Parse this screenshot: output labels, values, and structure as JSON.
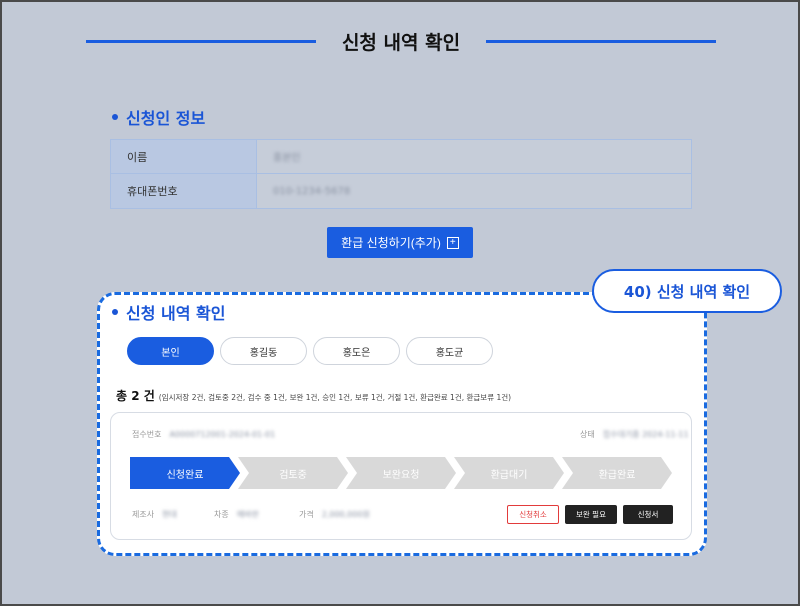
{
  "page": {
    "title": "신청 내역 확인"
  },
  "applicant": {
    "heading": "신청인 정보",
    "rows": [
      {
        "label": "이름",
        "value": "홍본인"
      },
      {
        "label": "휴대폰번호",
        "value": "010-1234-5678"
      }
    ]
  },
  "add_button": {
    "label": "환급 신청하기(추가)",
    "icon": "plus-icon"
  },
  "history": {
    "heading": "신청 내역 확인",
    "callout": "40) 신청 내역 확인",
    "tabs": [
      {
        "label": "본인",
        "active": true
      },
      {
        "label": "홍길동",
        "active": false
      },
      {
        "label": "홍도은",
        "active": false
      },
      {
        "label": "홍도균",
        "active": false
      }
    ],
    "total_label": "총 2 건",
    "total_detail": "(임시저장 2건, 검토중 2건, 검수 중 1건, 보완 1건, 승인 1건, 보류 1건, 거절 1건, 환급완료 1건, 환급보류 1건)",
    "item": {
      "receipt_label": "접수번호",
      "receipt_value": "A0000712001-2024-01-01",
      "status_label": "상태",
      "status_value": "접수대기중 2024-11-11",
      "steps": [
        {
          "label": "신청완료",
          "active": true
        },
        {
          "label": "검토중",
          "active": false
        },
        {
          "label": "보완요청",
          "active": false
        },
        {
          "label": "환급대기",
          "active": false
        },
        {
          "label": "환급완료",
          "active": false
        }
      ],
      "fields": [
        {
          "label": "제조사",
          "value": "현대"
        },
        {
          "label": "차종",
          "value": "에바란"
        },
        {
          "label": "가격",
          "value": "2,000,000원"
        }
      ],
      "buttons": {
        "cancel": "신청취소",
        "supplement": "보완 필요",
        "form": "신청서"
      }
    }
  },
  "colors": {
    "primary": "#1a5de0",
    "danger": "#e23b3b",
    "dark": "#222222"
  }
}
